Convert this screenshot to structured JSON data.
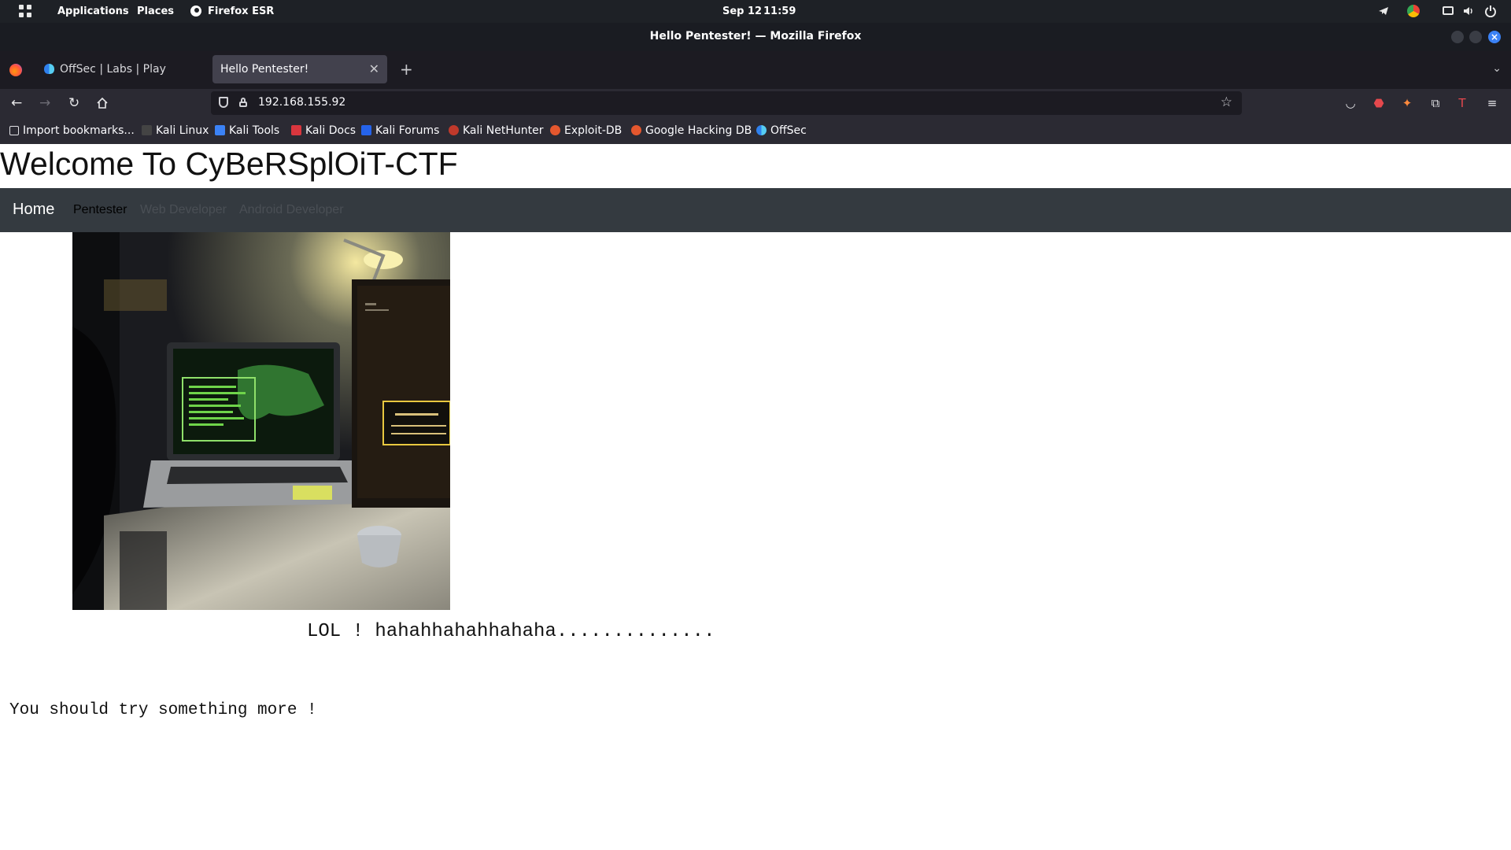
{
  "system_panel": {
    "applications": "Applications",
    "places": "Places",
    "active_app": "Firefox ESR",
    "date": "Sep 12",
    "time": "11:59"
  },
  "window": {
    "title": "Hello Pentester! — Mozilla Firefox"
  },
  "tabs": [
    {
      "label": "OffSec | Labs | Play",
      "active": false
    },
    {
      "label": "Hello Pentester!",
      "active": true
    }
  ],
  "urlbar": {
    "url": "192.168.155.92"
  },
  "bookmarks": [
    {
      "label": "Import bookmarks...",
      "icon": "import-icon"
    },
    {
      "label": "Kali Linux",
      "icon": "kali-dragon-icon"
    },
    {
      "label": "Kali Tools",
      "icon": "kali-tools-icon"
    },
    {
      "label": "Kali Docs",
      "icon": "kali-docs-icon"
    },
    {
      "label": "Kali Forums",
      "icon": "kali-forums-icon"
    },
    {
      "label": "Kali NetHunter",
      "icon": "nethunter-icon"
    },
    {
      "label": "Exploit-DB",
      "icon": "exploit-db-icon"
    },
    {
      "label": "Google Hacking DB",
      "icon": "ghdb-icon"
    },
    {
      "label": "OffSec",
      "icon": "offsec-icon"
    }
  ],
  "site": {
    "title": "Welcome To CyBeRSplOiT-CTF",
    "nav": {
      "brand": "Home",
      "links": [
        "Pentester",
        "Web Developer",
        "Android Developer"
      ]
    },
    "lol_text": "LOL ! hahahhahahhahaha..............",
    "try_text": "You should try something more !"
  },
  "colors": {
    "panel_bg": "#1e2126",
    "toolbar_bg": "#2b2a33",
    "tabbar_bg": "#1c1b22",
    "site_nav_bg": "#343a40",
    "nav_link_active": "#000000",
    "nav_link_muted": "#4a4f55"
  }
}
